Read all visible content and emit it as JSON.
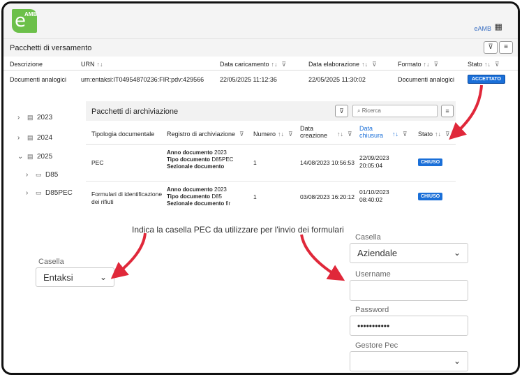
{
  "header": {
    "logo_letter": "e",
    "logo_sup": "AMB",
    "brand": "eAMB",
    "brand_icon": "building-icon"
  },
  "title": "Pacchetti di versamento",
  "main_table": {
    "headers": {
      "descrizione": "Descrizione",
      "urn": "URN",
      "data_caricamento": "Data caricamento",
      "data_elaborazione": "Data elaborazione",
      "formato": "Formato",
      "stato": "Stato"
    },
    "row": {
      "descrizione": "Documenti analogici",
      "urn": "urn:entaksi:IT04954870236:FIR:pdv:429566",
      "data_caricamento": "22/05/2025 11:12:36",
      "data_elaborazione": "22/05/2025 11:30:02",
      "formato": "Documenti analogici",
      "stato": "ACCETTATO"
    }
  },
  "tree": [
    {
      "label": "2023",
      "chevron": "›",
      "icon": "calendar-icon"
    },
    {
      "label": "2024",
      "chevron": "›",
      "icon": "calendar-icon"
    },
    {
      "label": "2025",
      "chevron": "⌄",
      "icon": "calendar-icon"
    },
    {
      "label": "D85",
      "chevron": "›",
      "icon": "folder-icon"
    },
    {
      "label": "D85PEC",
      "chevron": "›",
      "icon": "folder-icon"
    }
  ],
  "archive": {
    "title": "Pacchetti di archiviazione",
    "search_placeholder": "Ricerca",
    "columns": {
      "tipologia": "Tipologia documentale",
      "registro": "Registro di archiviazione",
      "numero": "Numero",
      "data_creazione_1": "Data",
      "data_creazione_2": "creazione",
      "data_chiusura_1": "Data",
      "data_chiusura_2": "chiusura",
      "stato": "Stato"
    },
    "rows": [
      {
        "tipologia": "PEC",
        "anno_label": "Anno documento",
        "anno": "2023",
        "tipo_label": "Tipo documento",
        "tipo": "D85PEC",
        "sezionale_label": "Sezionale documento",
        "sezionale": "",
        "numero": "1",
        "data_creazione": "14/08/2023 10:56:53",
        "data_chiusura_1": "22/09/2023",
        "data_chiusura_2": "20:05:04",
        "stato": "CHIUSO"
      },
      {
        "tipologia": "Formulari di identificazione dei rifiuti",
        "anno_label": "Anno documento",
        "anno": "2023",
        "tipo_label": "Tipo documento",
        "tipo": "D85",
        "sezionale_label": "Sezionale documento",
        "sezionale": "fir",
        "numero": "1",
        "data_creazione": "03/08/2023 16:20:12",
        "data_chiusura_1": "01/10/2023",
        "data_chiusura_2": "08:40:02",
        "stato": "CHIUSO"
      }
    ]
  },
  "instruction": "Indica la casella PEC da utilizzare per l'invio dei formulari",
  "left_form": {
    "casella_label": "Casella",
    "casella_value": "Entaksi"
  },
  "right_form": {
    "casella_label": "Casella",
    "casella_value": "Aziendale",
    "username_label": "Username",
    "username_value": "",
    "password_label": "Password",
    "password_value": "•••••••••••",
    "gestore_label": "Gestore Pec",
    "gestore_value": ""
  },
  "colors": {
    "accent_blue": "#1a6fd8",
    "arrow_red": "#e0283a",
    "logo_green": "#6cc04a"
  }
}
